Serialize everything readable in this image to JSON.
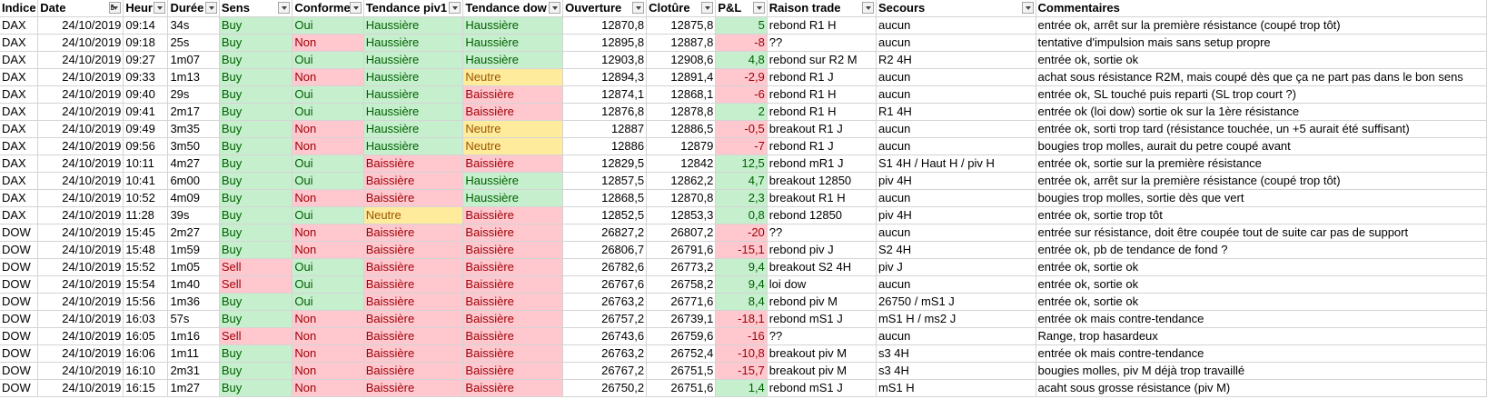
{
  "headers": [
    "Indice",
    "Date",
    "Heur",
    "Durée",
    "Sens",
    "Conforme",
    "Tendance piv1",
    "Tendance dow",
    "Ouverture",
    "Clotûre",
    "P&L",
    "Raison trade",
    "Secours",
    "Commentaires"
  ],
  "colors": {
    "green_bg": "#c6efce",
    "green_fg": "#006100",
    "red_bg": "#ffc7ce",
    "red_fg": "#9c0006",
    "yellow_bg": "#ffeb9c",
    "yellow_fg": "#9c5700"
  },
  "rows": [
    [
      "DAX",
      "24/10/2019",
      "09:14",
      "34s",
      "Buy",
      "Oui",
      "Haussière",
      "Haussière",
      "12870,8",
      "12875,8",
      "5",
      "rebond R1 H",
      "aucun",
      "entrée ok, arrêt sur la première résistance (coupé trop tôt)"
    ],
    [
      "DAX",
      "24/10/2019",
      "09:18",
      "25s",
      "Buy",
      "Non",
      "Haussière",
      "Haussière",
      "12895,8",
      "12887,8",
      "-8",
      "??",
      "aucun",
      "tentative d'impulsion mais sans setup propre"
    ],
    [
      "DAX",
      "24/10/2019",
      "09:27",
      "1m07",
      "Buy",
      "Oui",
      "Haussière",
      "Haussière",
      "12903,8",
      "12908,6",
      "4,8",
      "rebond sur R2 M",
      "R2 4H",
      "entrée ok, sortie ok"
    ],
    [
      "DAX",
      "24/10/2019",
      "09:33",
      "1m13",
      "Buy",
      "Non",
      "Haussière",
      "Neutre",
      "12894,3",
      "12891,4",
      "-2,9",
      "rebond R1 J",
      "aucun",
      "achat sous résistance R2M, mais coupé dès que ça ne part pas dans le bon sens"
    ],
    [
      "DAX",
      "24/10/2019",
      "09:40",
      "29s",
      "Buy",
      "Oui",
      "Haussière",
      "Baissière",
      "12874,1",
      "12868,1",
      "-6",
      "rebond R1 H",
      "aucun",
      "entrée ok, SL touché puis reparti (SL trop court ?)"
    ],
    [
      "DAX",
      "24/10/2019",
      "09:41",
      "2m17",
      "Buy",
      "Oui",
      "Haussière",
      "Baissière",
      "12876,8",
      "12878,8",
      "2",
      "rebond R1 H",
      "R1 4H",
      "entrée ok (loi dow) sortie ok sur la 1ère résistance"
    ],
    [
      "DAX",
      "24/10/2019",
      "09:49",
      "3m35",
      "Buy",
      "Non",
      "Haussière",
      "Neutre",
      "12887",
      "12886,5",
      "-0,5",
      "breakout R1 J",
      "aucun",
      "entrée ok, sorti trop tard (résistance touchée, un +5 aurait été suffisant)"
    ],
    [
      "DAX",
      "24/10/2019",
      "09:56",
      "3m50",
      "Buy",
      "Non",
      "Haussière",
      "Neutre",
      "12886",
      "12879",
      "-7",
      "rebond R1 J",
      "aucun",
      "bougies trop molles, aurait du petre coupé avant"
    ],
    [
      "DAX",
      "24/10/2019",
      "10:11",
      "4m27",
      "Buy",
      "Oui",
      "Baissière",
      "Baissière",
      "12829,5",
      "12842",
      "12,5",
      "rebond mR1 J",
      "S1 4H / Haut H / piv H",
      "entrée ok, sortie sur la première résistance"
    ],
    [
      "DAX",
      "24/10/2019",
      "10:41",
      "6m00",
      "Buy",
      "Oui",
      "Baissière",
      "Haussière",
      "12857,5",
      "12862,2",
      "4,7",
      "breakout 12850",
      "piv 4H",
      "entrée ok, arrêt sur la première résistance (coupé trop tôt)"
    ],
    [
      "DAX",
      "24/10/2019",
      "10:52",
      "4m09",
      "Buy",
      "Non",
      "Baissière",
      "Haussière",
      "12868,5",
      "12870,8",
      "2,3",
      "breakout R1 H",
      "aucun",
      "bougies trop molles, sortie dès que vert"
    ],
    [
      "DAX",
      "24/10/2019",
      "11:28",
      "39s",
      "Buy",
      "Oui",
      "Neutre",
      "Baissière",
      "12852,5",
      "12853,3",
      "0,8",
      "rebond 12850",
      "piv 4H",
      "entrée ok, sortie trop tôt"
    ],
    [
      "DOW",
      "24/10/2019",
      "15:45",
      "2m27",
      "Buy",
      "Non",
      "Baissière",
      "Baissière",
      "26827,2",
      "26807,2",
      "-20",
      "??",
      "aucun",
      "entrée sur résistance, doit être coupée tout de suite car pas de support"
    ],
    [
      "DOW",
      "24/10/2019",
      "15:48",
      "1m59",
      "Buy",
      "Non",
      "Baissière",
      "Baissière",
      "26806,7",
      "26791,6",
      "-15,1",
      "rebond piv J",
      "S2 4H",
      "entrée ok, pb de tendance de fond ?"
    ],
    [
      "DOW",
      "24/10/2019",
      "15:52",
      "1m05",
      "Sell",
      "Oui",
      "Baissière",
      "Baissière",
      "26782,6",
      "26773,2",
      "9,4",
      "breakout S2 4H",
      "piv J",
      "entrée ok, sortie ok"
    ],
    [
      "DOW",
      "24/10/2019",
      "15:54",
      "1m40",
      "Sell",
      "Oui",
      "Baissière",
      "Baissière",
      "26767,6",
      "26758,2",
      "9,4",
      "loi dow",
      "aucun",
      "entrée ok, sortie ok"
    ],
    [
      "DOW",
      "24/10/2019",
      "15:56",
      "1m36",
      "Buy",
      "Oui",
      "Baissière",
      "Baissière",
      "26763,2",
      "26771,6",
      "8,4",
      "rebond piv M",
      "26750 / mS1 J",
      "entrée ok, sortie ok"
    ],
    [
      "DOW",
      "24/10/2019",
      "16:03",
      "57s",
      "Buy",
      "Non",
      "Baissière",
      "Baissière",
      "26757,2",
      "26739,1",
      "-18,1",
      "rebond mS1 J",
      "mS1 H / ms2 J",
      "entrée ok mais contre-tendance"
    ],
    [
      "DOW",
      "24/10/2019",
      "16:05",
      "1m16",
      "Sell",
      "Non",
      "Baissière",
      "Baissière",
      "26743,6",
      "26759,6",
      "-16",
      "??",
      "aucun",
      "Range, trop hasardeux"
    ],
    [
      "DOW",
      "24/10/2019",
      "16:06",
      "1m11",
      "Buy",
      "Non",
      "Baissière",
      "Baissière",
      "26763,2",
      "26752,4",
      "-10,8",
      "breakout piv M",
      "s3 4H",
      "entrée ok mais contre-tendance"
    ],
    [
      "DOW",
      "24/10/2019",
      "16:10",
      "2m31",
      "Buy",
      "Non",
      "Baissière",
      "Baissière",
      "26767,2",
      "26751,5",
      "-15,7",
      "breakout piv M",
      "s3 4H",
      "bougies molles, piv M déjà trop travaillé"
    ],
    [
      "DOW",
      "24/10/2019",
      "16:15",
      "1m27",
      "Buy",
      "Non",
      "Baissière",
      "Baissière",
      "26750,2",
      "26751,6",
      "1,4",
      "rebond mS1 J",
      "mS1 H",
      "acaht sous grosse résistance (piv M)"
    ]
  ]
}
